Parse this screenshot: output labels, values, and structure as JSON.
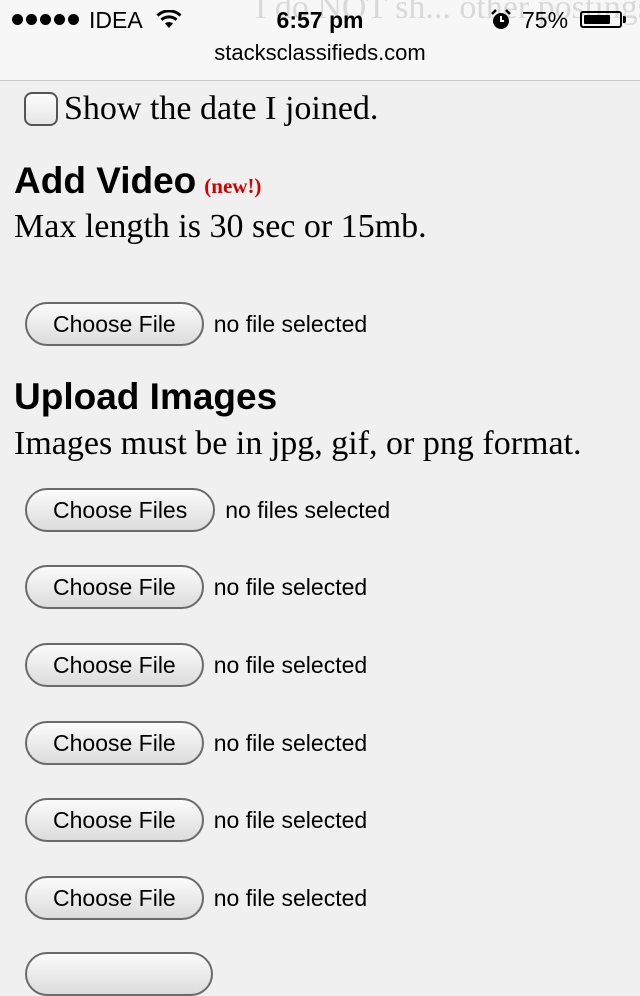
{
  "status_bar": {
    "carrier": "IDEA",
    "time": "6:57 pm",
    "battery_percent": "75%",
    "battery_level": 0.75,
    "icons": [
      "signal-dots-icon",
      "wifi-icon",
      "alarm-icon",
      "battery-icon"
    ]
  },
  "url_bar": {
    "domain": "stacksclassifieds.com"
  },
  "background_text": "I do NOT sh... other postings",
  "show_date": {
    "label": "Show the date I joined."
  },
  "add_video": {
    "heading": "Add Video",
    "badge": "(new!)",
    "note": "Max length is 30 sec or 15mb.",
    "button": "Choose File",
    "status": "no file selected"
  },
  "upload_images": {
    "heading": "Upload Images",
    "note": "Images must be in jpg, gif, or png format.",
    "multi_button": "Choose Files",
    "multi_status": "no files selected",
    "inputs": [
      {
        "button": "Choose File",
        "status": "no file selected"
      },
      {
        "button": "Choose File",
        "status": "no file selected"
      },
      {
        "button": "Choose File",
        "status": "no file selected"
      },
      {
        "button": "Choose File",
        "status": "no file selected"
      },
      {
        "button": "Choose File",
        "status": "no file selected"
      }
    ]
  },
  "colors": {
    "badge": "#d40000",
    "page_bg": "#f0f0f0"
  }
}
